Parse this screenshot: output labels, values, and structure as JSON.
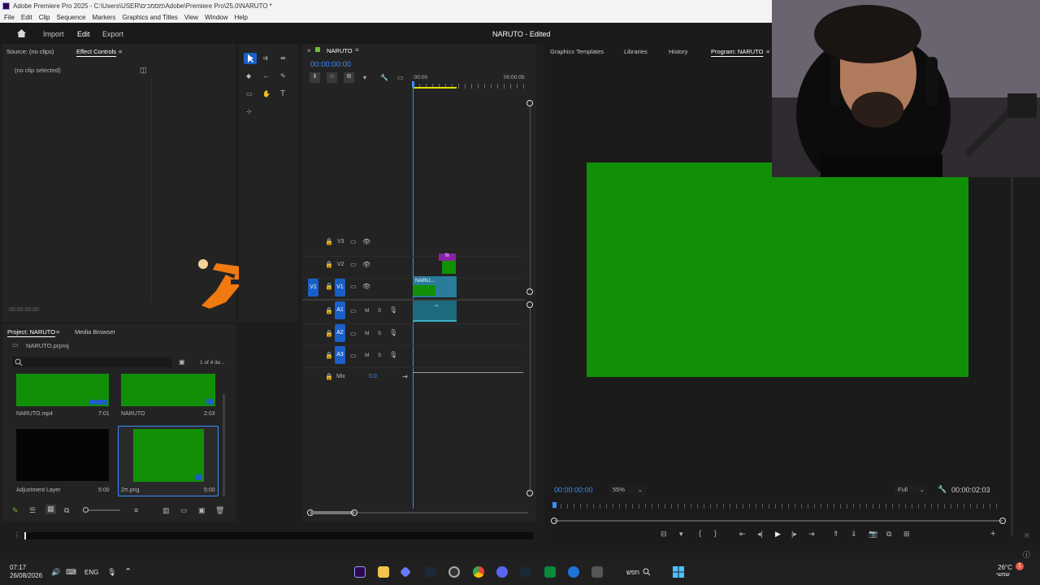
{
  "window": {
    "title": "Adobe Premiere Pro 2025 - C:\\Users\\USER\\מסמכים\\Adobe\\Premiere Pro\\25.0\\NARUTO *",
    "menu": [
      "File",
      "Edit",
      "Clip",
      "Sequence",
      "Markers",
      "Graphics and Titles",
      "View",
      "Window",
      "Help"
    ]
  },
  "workspace": {
    "tabs": [
      "Import",
      "Edit",
      "Export"
    ],
    "active": "Edit",
    "project_title": "NARUTO - Edited"
  },
  "source_panel": {
    "tab_source": "Source: (no clips)",
    "tab_effect_controls": "Effect Controls",
    "no_clip_text": "(no clip selected)",
    "timecode": "00:00:00:00"
  },
  "project_panel": {
    "tab_project": "Project: NARUTO",
    "tab_media_browser": "Media Browser",
    "project_file": "NARUTO.prproj",
    "item_count": "1 of 4 ite...",
    "items": [
      {
        "name": "NARUTO.mp4",
        "duration": "7:01",
        "thumb": "green"
      },
      {
        "name": "NARUTO",
        "duration": "2:03",
        "thumb": "green"
      },
      {
        "name": "Adjustment Layer",
        "duration": "5:00",
        "thumb": "black"
      },
      {
        "name": "2ת.png",
        "duration": "5:00",
        "thumb": "green"
      }
    ]
  },
  "timeline": {
    "sequence_tab": "NARUTO",
    "timecode": "00:00:00:00",
    "ruler_start": ":00:00",
    "ruler_end": "00:00:05:",
    "video_tracks": [
      "V3",
      "V2",
      "V1"
    ],
    "audio_tracks": [
      "A1",
      "A2",
      "A3"
    ],
    "source_patch_v": "V1",
    "mix_label": "Mix",
    "mix_value": "0.0",
    "clip_v1_label": "NARU...",
    "fx_label": "fx",
    "mute_label": "M",
    "solo_label": "S"
  },
  "program_panel": {
    "tabs": [
      "Graphics Templates",
      "Libraries",
      "History",
      "Program: NARUTO"
    ],
    "active_tab": "Program: NARUTO",
    "timecode_left": "00:00:00:00",
    "zoom": "55%",
    "quality": "Full",
    "timecode_right": "00:00:02:03"
  },
  "taskbar": {
    "time": "07:17",
    "date": "26/08/2026",
    "language": "ENG",
    "search_label": "חפש",
    "weather_temp": "26°C",
    "weather_desc": "שמשי",
    "notification_count": "1",
    "pinned_apps": [
      "premiere-pro-icon",
      "file-explorer-icon",
      "vscode-icon",
      "steam-icon",
      "obs-icon",
      "chrome-icon",
      "discord-icon",
      "steam-alt-icon",
      "live-icon",
      "edge-icon",
      "calculator-icon"
    ]
  },
  "colors": {
    "accent_blue": "#1a5fc7",
    "timecode_blue": "#3a8dff",
    "green_screen": "#119007",
    "panel_bg": "#232323",
    "fx_purple": "#8b22a8"
  }
}
